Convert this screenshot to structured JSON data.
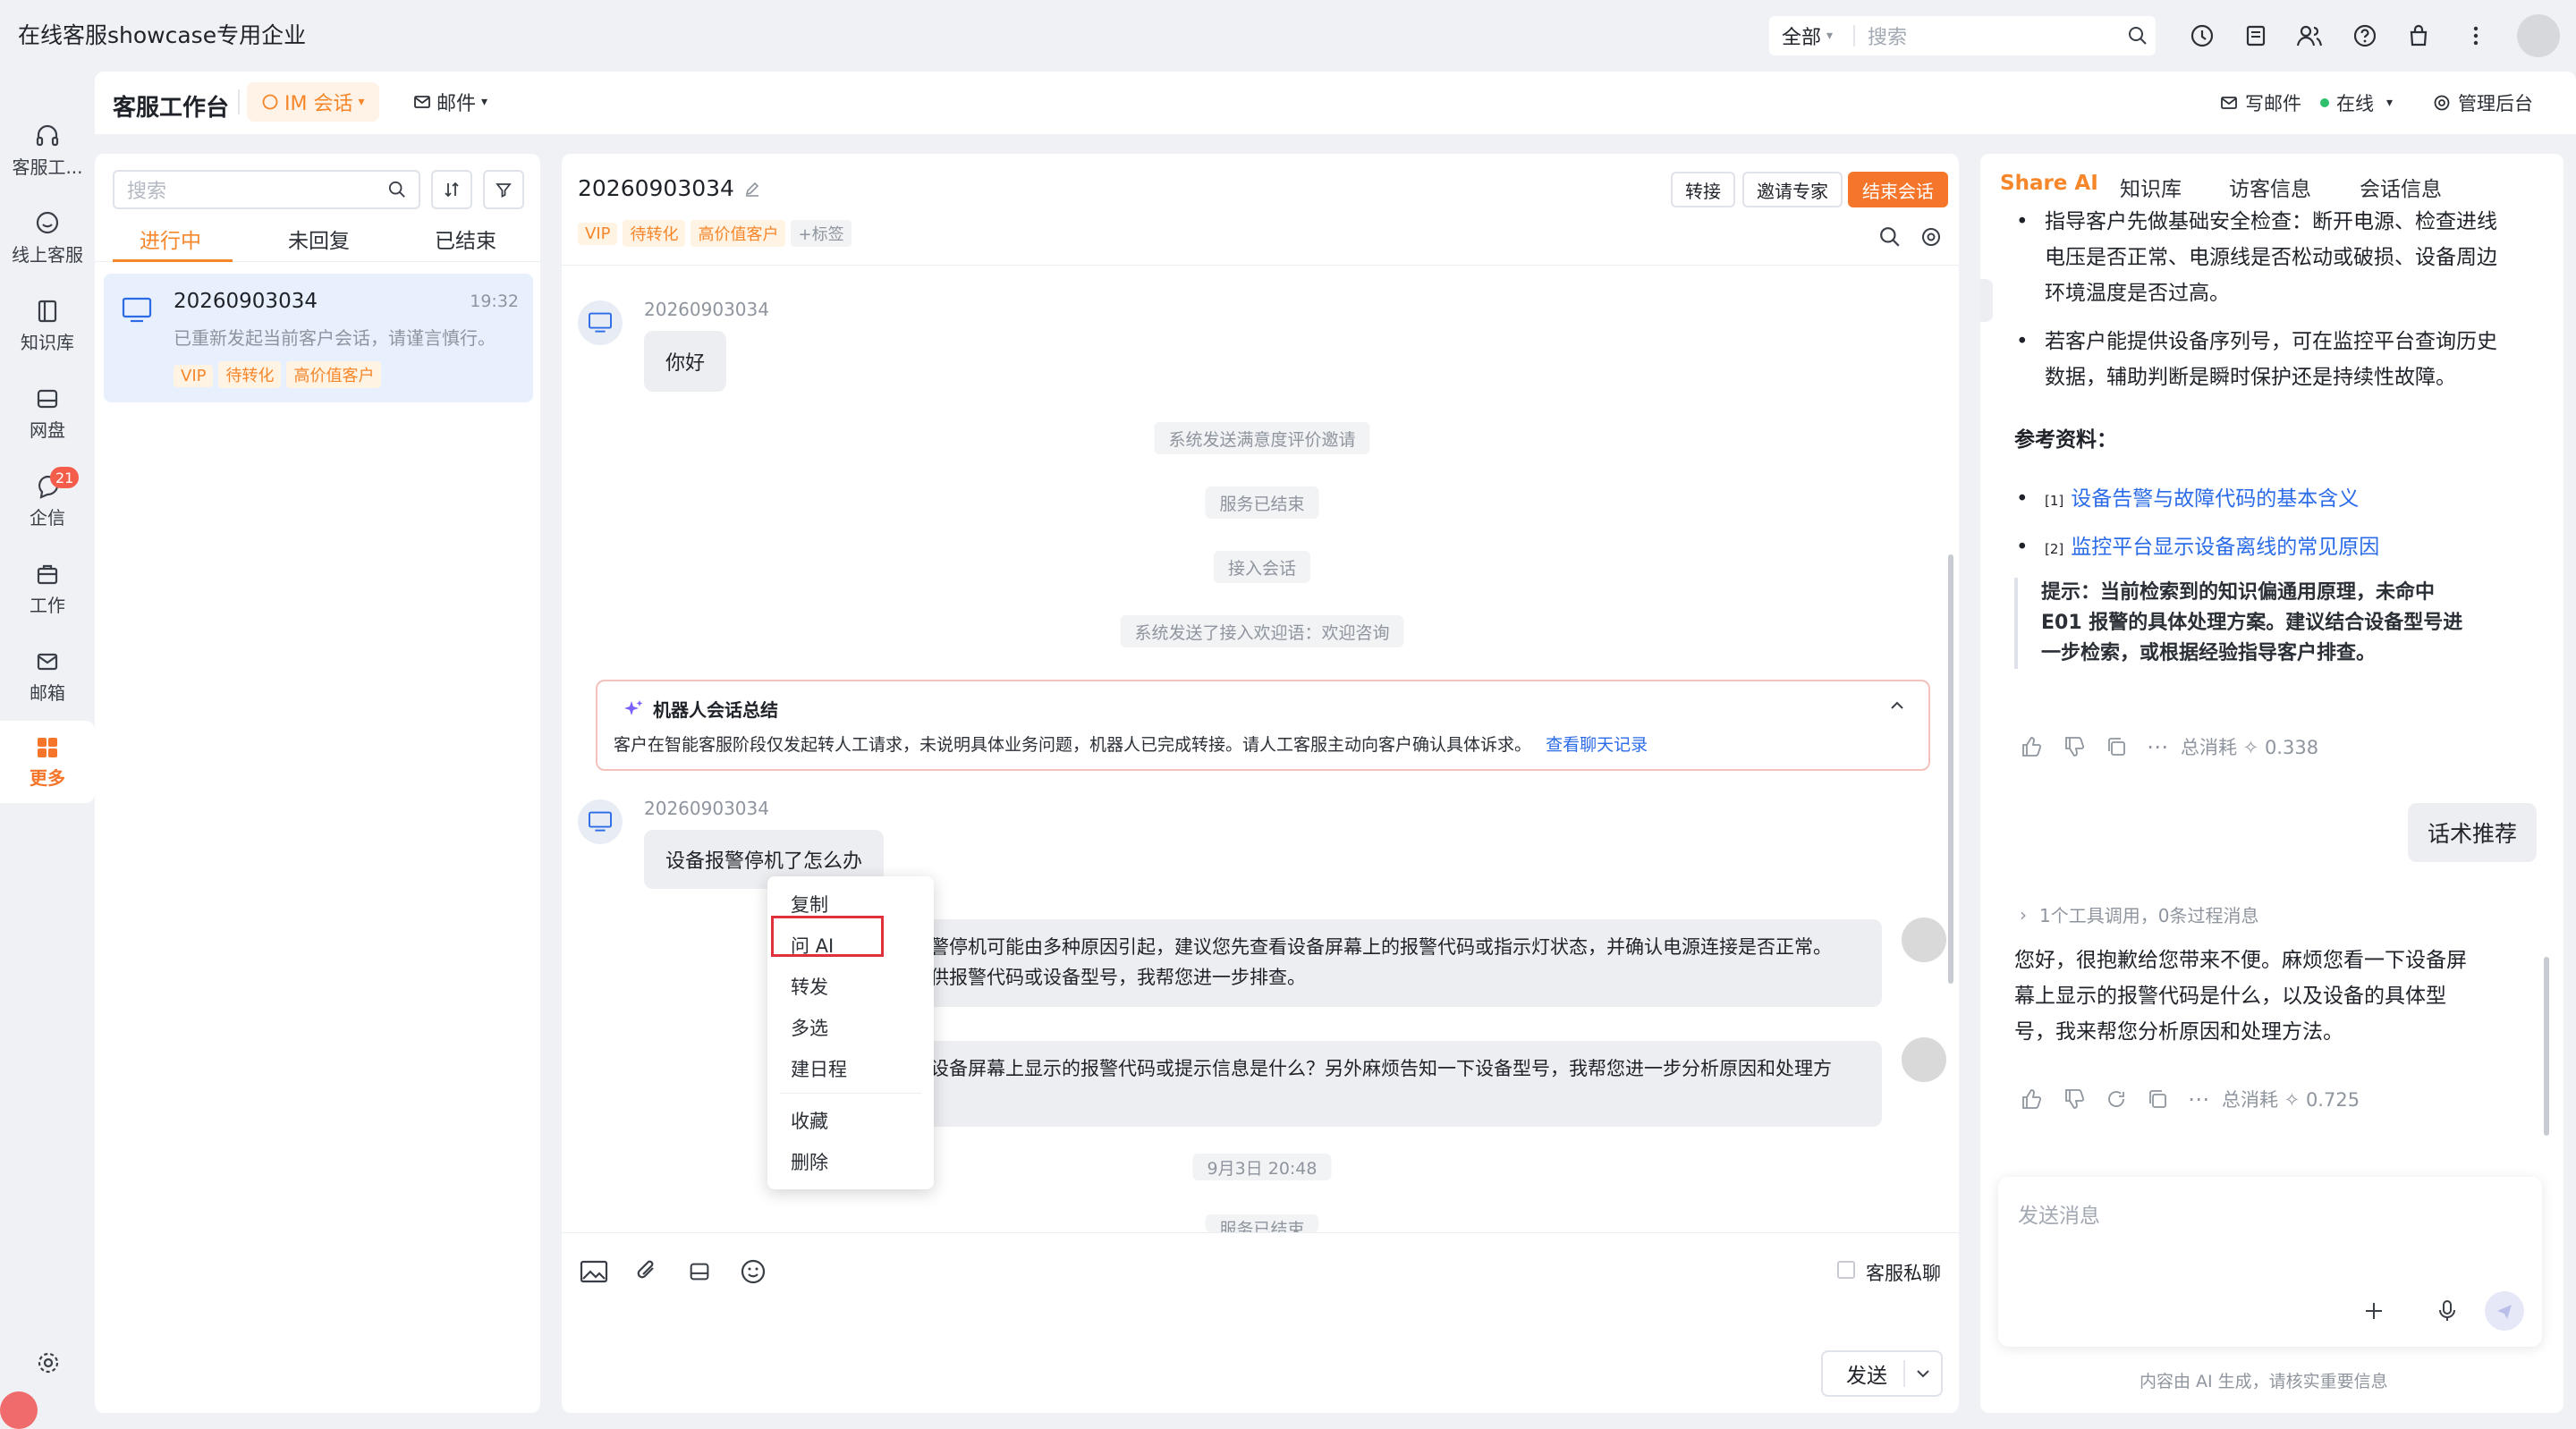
{
  "app": {
    "company": "在线客服showcase专用企业"
  },
  "topsearch": {
    "scope": "全部",
    "placeholder": "搜索"
  },
  "nav": {
    "items": [
      {
        "label": "客服工..."
      },
      {
        "label": "线上客服"
      },
      {
        "label": "知识库"
      },
      {
        "label": "网盘"
      },
      {
        "label": "企信",
        "badge": "21"
      },
      {
        "label": "工作"
      },
      {
        "label": "邮箱"
      },
      {
        "label": "更多"
      }
    ]
  },
  "workspace": {
    "title": "客服工作台",
    "im_tab": "IM 会话",
    "mail_tab": "邮件",
    "write_mail": "写邮件",
    "status": "在线",
    "admin": "管理后台"
  },
  "convlist": {
    "search_placeholder": "搜索",
    "tabs": [
      "进行中",
      "未回复",
      "已结束"
    ],
    "item": {
      "id": "20260903034",
      "time": "19:32",
      "preview": "已重新发起当前客户会话，请谨言慎行。",
      "tags": [
        "VIP",
        "待转化",
        "高价值客户"
      ]
    }
  },
  "chat": {
    "id": "20260903034",
    "tags": [
      "VIP",
      "待转化",
      "高价值客户"
    ],
    "add_tag": "+标签",
    "buttons": {
      "transfer": "转接",
      "invite": "邀请专家",
      "end": "结束会话"
    },
    "msg1": {
      "sender": "20260903034",
      "text": "你好"
    },
    "system": [
      "系统发送满意度评价邀请",
      "服务已结束",
      "接入会话",
      "系统发送了接入欢迎语：欢迎咨询"
    ],
    "summary": {
      "title": "机器人会话总结",
      "body": "客户在智能客服阶段仅发起转人工请求，未说明具体业务问题，机器人已完成转接。请人工客服主动向客户确认具体诉求。",
      "link": "查看聊天记录"
    },
    "msg2": {
      "sender": "20260903034",
      "text": "设备报警停机了怎么办"
    },
    "reply1_line1": "警停机可能由多种原因引起，建议您先查看设备屏幕上的报警代码或指示灯状态，并确认电源连接是否正常。",
    "reply1_line2": "供报警代码或设备型号，我帮您进一步排查。",
    "reply2_line1": "设备屏幕上显示的报警代码或提示信息是什么？另外麻烦告知一下设备型号，我帮您进一步分析原因和处理方",
    "date_sep": "9月3日 20:48",
    "last_sys": "服务已结束",
    "private_chat": "客服私聊",
    "send": "发送"
  },
  "context_menu": [
    "复制",
    "问 AI",
    "转发",
    "多选",
    "建日程",
    "收藏",
    "删除"
  ],
  "ai": {
    "tabs": [
      "Share AI",
      "知识库",
      "访客信息",
      "会话信息"
    ],
    "bullet1": [
      "指导客户先做基础安全检查：断开电源、检查进线",
      "电压是否正常、电源线是否松动或破损、设备周边",
      "环境温度是否过高。"
    ],
    "bullet2": [
      "若客户能提供设备序列号，可在监控平台查询历史",
      "数据，辅助判断是瞬时保护还是持续性故障。"
    ],
    "refs_title": "参考资料：",
    "refs": [
      {
        "num": "[1]",
        "text": "设备告警与故障代码的基本含义"
      },
      {
        "num": "[2]",
        "text": "监控平台显示设备离线的常见原因"
      }
    ],
    "tip": [
      "提示：当前检索到的知识偏通用原理，未命中",
      "E01 报警的具体处理方案。建议结合设备型号进",
      "一步检索，或根据经验指导客户排查。"
    ],
    "cost1": "总消耗 ✧ 0.338",
    "script_btn": "话术推荐",
    "tool_line": "1个工具调用，0条过程消息",
    "answer": [
      "您好，很抱歉给您带来不便。麻烦您看一下设备屏",
      "幕上显示的报警代码是什么，以及设备的具体型",
      "号，我来帮您分析原因和处理方法。"
    ],
    "cost2": "总消耗 ✧ 0.725",
    "input_placeholder": "发送消息",
    "disclaimer": "内容由 AI 生成，请核实重要信息"
  }
}
